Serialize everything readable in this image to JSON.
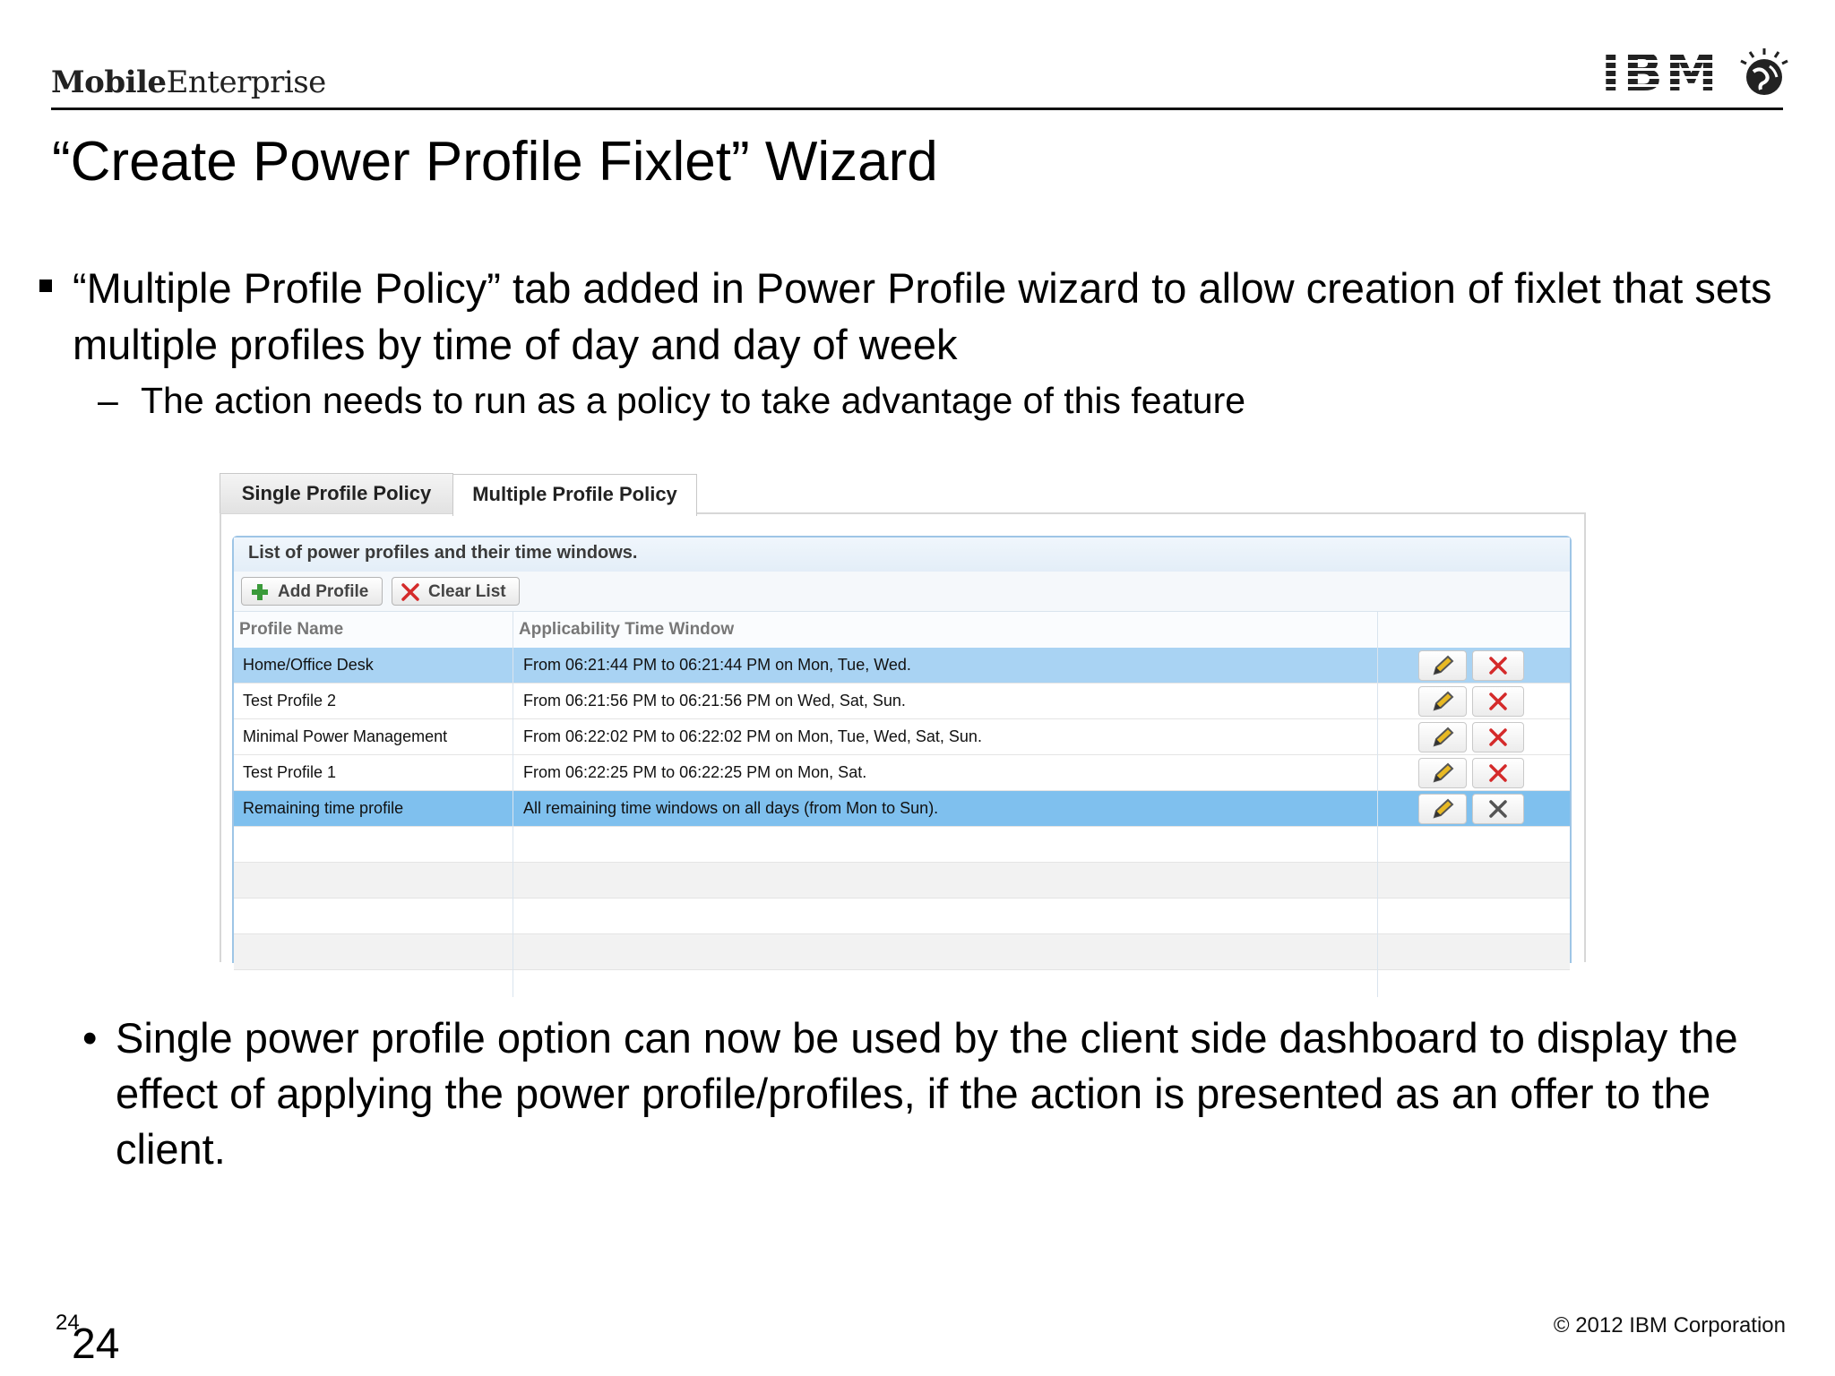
{
  "header": {
    "brand_bold": "Mobile",
    "brand_rest": "Enterprise",
    "logo_text": "IBM"
  },
  "slide": {
    "title": "“Create Power Profile Fixlet” Wizard",
    "bullet1": "“Multiple Profile Policy” tab added in Power Profile wizard to allow creation of fixlet that sets multiple profiles by time of day and day of week",
    "sub_bullet": "The action needs to run as a policy to take advantage of this feature",
    "bullet2": "Single power profile option can now be used by the client side dashboard to display the effect of applying the power profile/profiles, if the action is presented as an offer to the client.",
    "bullet2_marker": "•",
    "sub_marker": "–"
  },
  "wizard": {
    "tabs": [
      {
        "label": "Single Profile Policy",
        "active": false
      },
      {
        "label": "Multiple Profile Policy",
        "active": true
      }
    ],
    "legend": "List of power profiles and their time windows.",
    "add_button": "Add Profile",
    "clear_button": "Clear List",
    "columns": [
      "Profile Name",
      "Applicability Time Window"
    ],
    "rows": [
      {
        "name": "Home/Office Desk",
        "window": "From 06:21:44 PM to 06:21:44 PM on Mon, Tue, Wed.",
        "state": "selected"
      },
      {
        "name": "Test Profile 2",
        "window": "From 06:21:56 PM to 06:21:56 PM on Wed, Sat, Sun.",
        "state": "normal"
      },
      {
        "name": "Minimal Power Management",
        "window": "From 06:22:02 PM to 06:22:02 PM on Mon, Tue, Wed, Sat, Sun.",
        "state": "normal"
      },
      {
        "name": "Test Profile 1",
        "window": "From 06:22:25 PM to 06:22:25 PM on Mon, Sat.",
        "state": "normal"
      },
      {
        "name": "Remaining time profile",
        "window": "All remaining time windows on all days (from Mon to Sun).",
        "state": "selected"
      }
    ],
    "colors": {
      "selected_row": "#a9d3f3",
      "delete_red": "#d42a2a",
      "add_green": "#3a9a3a"
    }
  },
  "footer": {
    "page_small": "24",
    "page_big": "24",
    "copyright": "© 2012 IBM Corporation"
  }
}
